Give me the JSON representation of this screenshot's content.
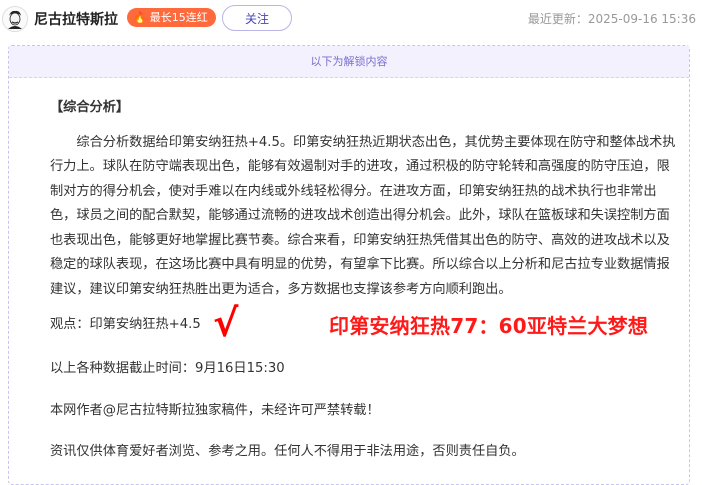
{
  "header": {
    "author": "尼古拉特斯拉",
    "badge": "最长15连红",
    "follow_label": "关注",
    "updated": "最近更新：2025-09-16 15:36"
  },
  "unlock": {
    "banner": "以下为解锁内容"
  },
  "article": {
    "section_title": "【综合分析】",
    "paragraph": "综合分析数据给印第安纳狂热+4.5。印第安纳狂热近期状态出色，其优势主要体现在防守和整体战术执行力上。球队在防守端表现出色，能够有效遏制对手的进攻，通过积极的防守轮转和高强度的防守压迫，限制对方的得分机会，使对手难以在内线或外线轻松得分。在进攻方面，印第安纳狂热的战术执行也非常出色，球员之间的配合默契，能够通过流畅的进攻战术创造出得分机会。此外，球队在篮板球和失误控制方面也表现出色，能够更好地掌握比赛节奏。综合来看，印第安纳狂热凭借其出色的防守、高效的进攻战术以及稳定的球队表现，在这场比赛中具有明显的优势，有望拿下比赛。所以综合以上分析和尼古拉专业数据情报建议，建议印第安纳狂热胜出更为适合，多方数据也支撑该参考方向顺利跑出。",
    "view": "观点：印第安纳狂热+4.5",
    "check_mark": "√",
    "result": "印第安纳狂热77：60亚特兰大梦想",
    "deadline": "以上各种数据截止时间：9月16日15:30",
    "copyright": "本网作者@尼古拉特斯拉独家稿件，未经许可严禁转载！",
    "disclaimer": "资讯仅供体育爱好者浏览、参考之用。任何人不得用于非法用途，否则责任自负。"
  },
  "colors": {
    "badge_bg": "#ff6a3d",
    "accent": "#4a43b8",
    "result_red": "#ff1a1a"
  },
  "icons": {
    "avatar": "tesla-portrait-avatar",
    "badge": "flame-icon"
  }
}
